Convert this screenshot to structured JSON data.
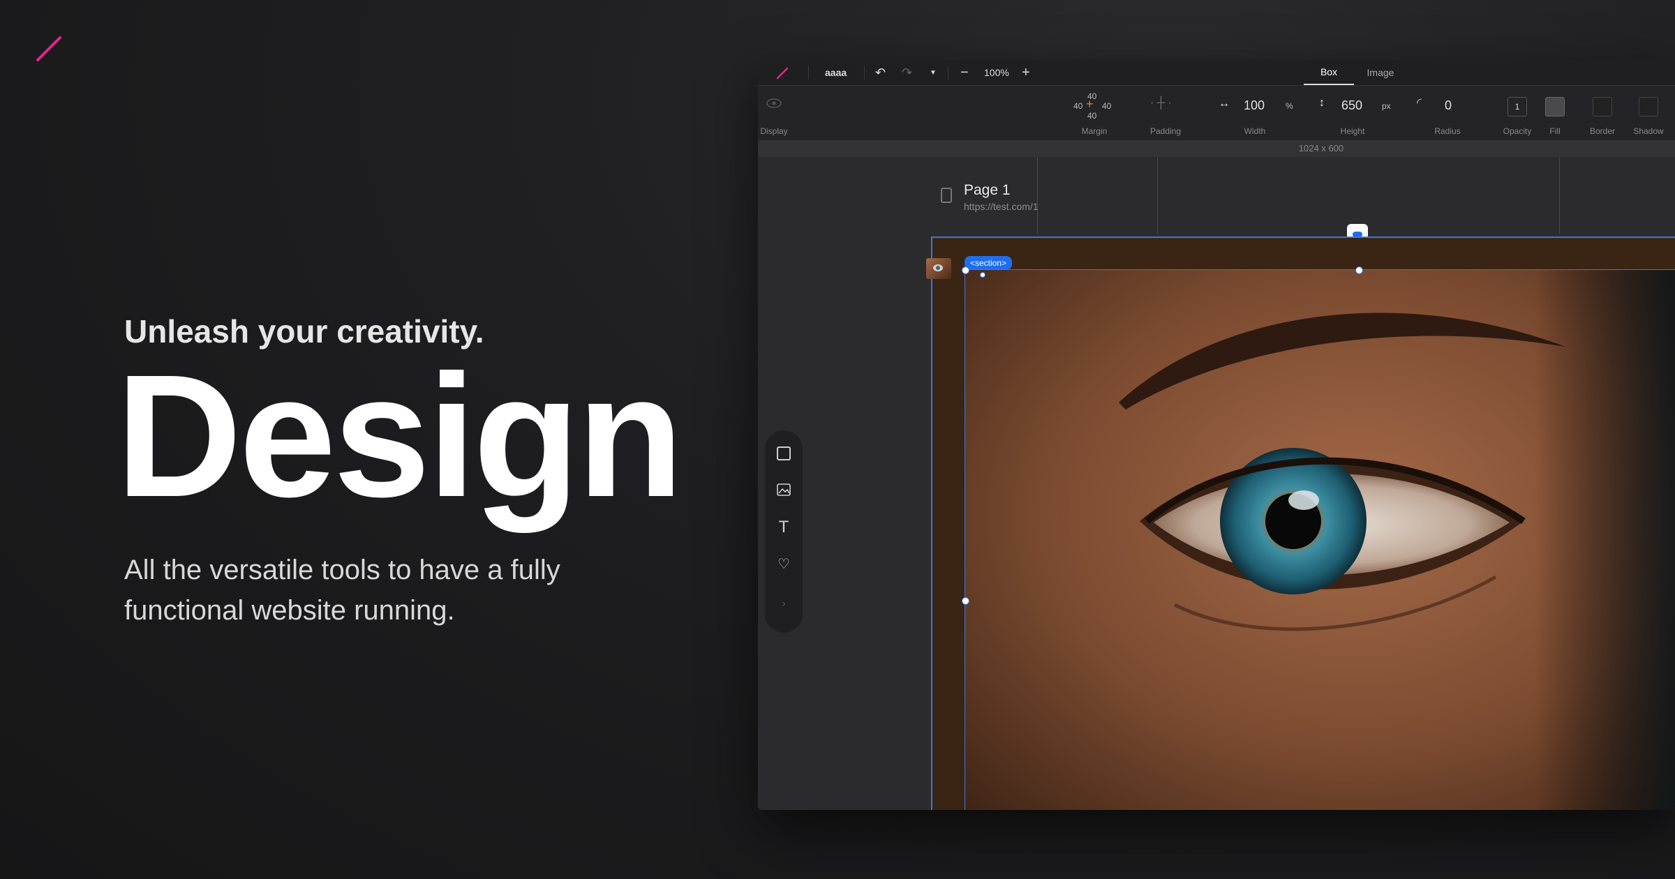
{
  "hero": {
    "tagline": "Unleash your creativity.",
    "headline": "Design",
    "description": "All the versatile tools to have a fully functional website running."
  },
  "colors": {
    "accent_pink": "#e0288a",
    "selection_blue": "#1e6ef0",
    "section_bg": "#3a2414"
  },
  "app": {
    "topbar": {
      "project_name": "aaaa",
      "zoom": "100%",
      "tabs": [
        {
          "label": "Box",
          "active": true
        },
        {
          "label": "Image",
          "active": false
        }
      ]
    },
    "properties": {
      "display_label": "Display",
      "margin": {
        "label": "Margin",
        "top": "40",
        "left": "40",
        "right": "40",
        "bottom": "40"
      },
      "padding": {
        "label": "Padding"
      },
      "width": {
        "label": "Width",
        "value": "100",
        "unit": "%"
      },
      "height": {
        "label": "Height",
        "value": "650",
        "unit": "px"
      },
      "radius": {
        "label": "Radius",
        "value": "0"
      },
      "opacity": {
        "label": "Opacity",
        "value": "1"
      },
      "fill_label": "Fill",
      "border_label": "Border",
      "shadow_label": "Shadow"
    },
    "ruler": {
      "viewport": "1024 x 600"
    },
    "page": {
      "title": "Page 1",
      "url": "https://test.com/1"
    },
    "selection": {
      "tag": "<section>"
    },
    "tools": [
      "box-tool",
      "image-tool",
      "text-tool",
      "icon-tool"
    ]
  }
}
